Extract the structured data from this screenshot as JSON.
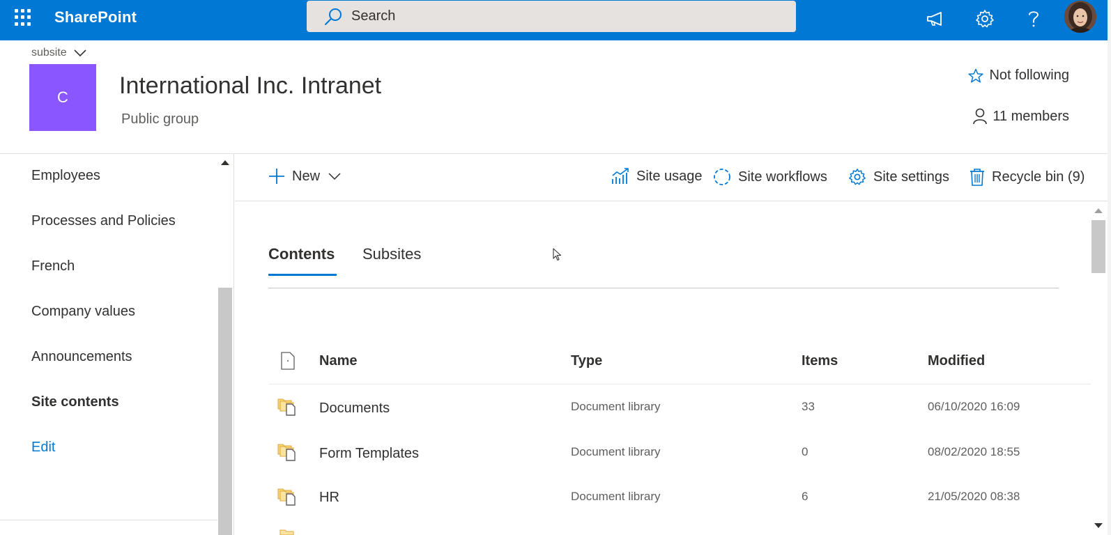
{
  "suitebar": {
    "brand": "SharePoint",
    "search_placeholder": "Search",
    "icons": [
      "app-launcher-icon",
      "megaphone-icon",
      "settings-gear-icon",
      "help-icon",
      "user-avatar"
    ]
  },
  "site": {
    "breadcrumb": "subsite",
    "logo_letter": "C",
    "title": "International Inc. Intranet",
    "subtitle": "Public group",
    "follow_label": "Not following",
    "members_label": "11 members",
    "logo_color": "#8a56ff"
  },
  "leftnav": {
    "items": [
      {
        "label": "Employees"
      },
      {
        "label": "Processes and Policies"
      },
      {
        "label": "French"
      },
      {
        "label": "Company values"
      },
      {
        "label": "Announcements"
      },
      {
        "label": "Site contents"
      }
    ],
    "edit_label": "Edit"
  },
  "commandbar": {
    "new_label": "New",
    "site_usage": "Site usage",
    "site_workflows": "Site workflows",
    "site_settings": "Site settings",
    "recycle_bin": "Recycle bin (9)"
  },
  "tabs": [
    {
      "label": "Contents",
      "active": true
    },
    {
      "label": "Subsites",
      "active": false
    }
  ],
  "table": {
    "headers": {
      "name": "Name",
      "type": "Type",
      "items": "Items",
      "modified": "Modified"
    },
    "rows": [
      {
        "name": "Documents",
        "type": "Document library",
        "items": "33",
        "modified": "06/10/2020 16:09"
      },
      {
        "name": "Form Templates",
        "type": "Document library",
        "items": "0",
        "modified": "08/02/2020 18:55"
      },
      {
        "name": "HR",
        "type": "Document library",
        "items": "6",
        "modified": "21/05/2020 08:38"
      }
    ]
  },
  "colors": {
    "suitebar": "#0078d4",
    "accent": "#0078d4",
    "search_bg": "#e5e2e0"
  }
}
